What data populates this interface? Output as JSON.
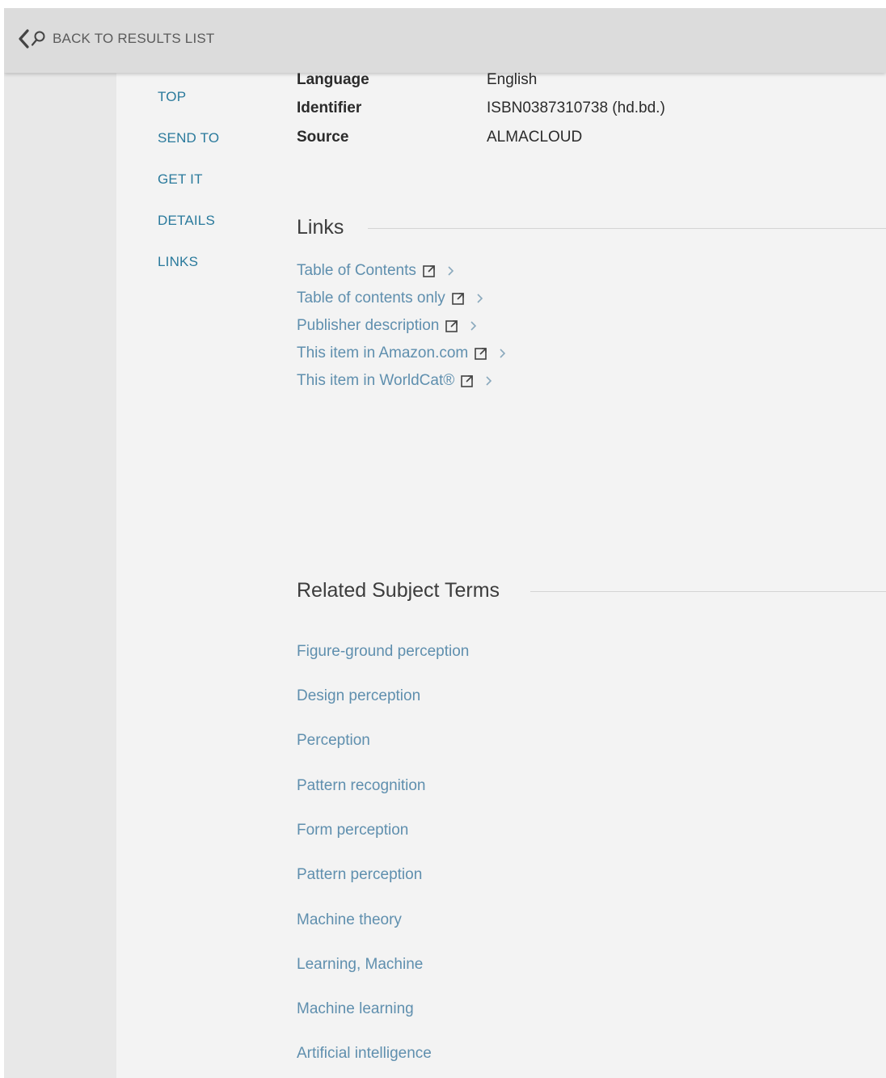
{
  "topbar": {
    "back_label": "BACK TO RESULTS LIST",
    "back_icon": "chevron-left-icon",
    "search_icon": "search-icon"
  },
  "sidenav": {
    "items": [
      "TOP",
      "SEND TO",
      "GET IT",
      "DETAILS",
      "LINKS"
    ]
  },
  "details": {
    "rows": [
      {
        "label": "Language",
        "value": "English"
      },
      {
        "label": "Identifier",
        "value": "ISBN0387310738 (hd.bd.)"
      },
      {
        "label": "Source",
        "value": "ALMACLOUD"
      }
    ]
  },
  "links": {
    "title": "Links",
    "items": [
      "Table of Contents",
      "Table of contents only",
      "Publisher description",
      "This item in Amazon.com",
      "This item in WorldCat®"
    ]
  },
  "subjects": {
    "title": "Related Subject Terms",
    "items": [
      "Figure-ground perception",
      "Design perception",
      "Perception",
      "Pattern recognition",
      "Form perception",
      "Pattern perception",
      "Machine theory",
      "Learning, Machine",
      "Machine learning",
      "Artificial intelligence"
    ]
  },
  "colors": {
    "nav_link": "#2a7a9c",
    "content_link": "#5f8fae",
    "topbar_bg": "#dcdcdc",
    "page_bg": "#f3f3f3"
  }
}
